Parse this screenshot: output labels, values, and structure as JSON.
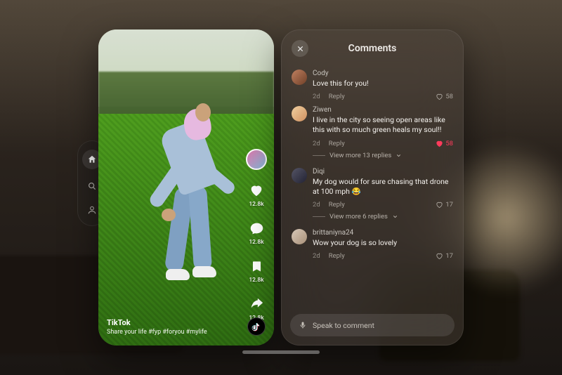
{
  "nav": {
    "items": [
      {
        "name": "home",
        "active": true
      },
      {
        "name": "search",
        "active": false
      },
      {
        "name": "profile",
        "active": false
      }
    ]
  },
  "video": {
    "brand": "TikTok",
    "caption": "Share your life #fyp #foryou #mylife",
    "actions": {
      "like_count": "12.8k",
      "comment_count": "12.8k",
      "bookmark_count": "12.8k",
      "share_count": "12.8k"
    }
  },
  "comments": {
    "title": "Comments",
    "input_placeholder": "Speak to comment",
    "items": [
      {
        "user": "Cody",
        "text": "Love this for you!",
        "time": "2d",
        "reply_label": "Reply",
        "likes": "58",
        "liked": false,
        "view_more": null,
        "avatar": "linear-gradient(135deg,#c08060,#704028)"
      },
      {
        "user": "Ziwen",
        "text": "I live in the city so seeing open areas like this with so much green heals my soul!!",
        "time": "2d",
        "reply_label": "Reply",
        "likes": "58",
        "liked": true,
        "view_more": "View more 13 replies",
        "avatar": "linear-gradient(135deg,#f0d0a0,#d09060)"
      },
      {
        "user": "Diqi",
        "text": "My dog would for sure chasing that drone at 100 mph 😂",
        "time": "2d",
        "reply_label": "Reply",
        "likes": "17",
        "liked": false,
        "view_more": "View more 6 replies",
        "avatar": "linear-gradient(135deg,#556,#223)"
      },
      {
        "user": "brittaniyna24",
        "text": "Wow your dog is so lovely",
        "time": "2d",
        "reply_label": "Reply",
        "likes": "17",
        "liked": false,
        "view_more": null,
        "avatar": "linear-gradient(135deg,#d8c8b8,#a89078)"
      }
    ]
  }
}
